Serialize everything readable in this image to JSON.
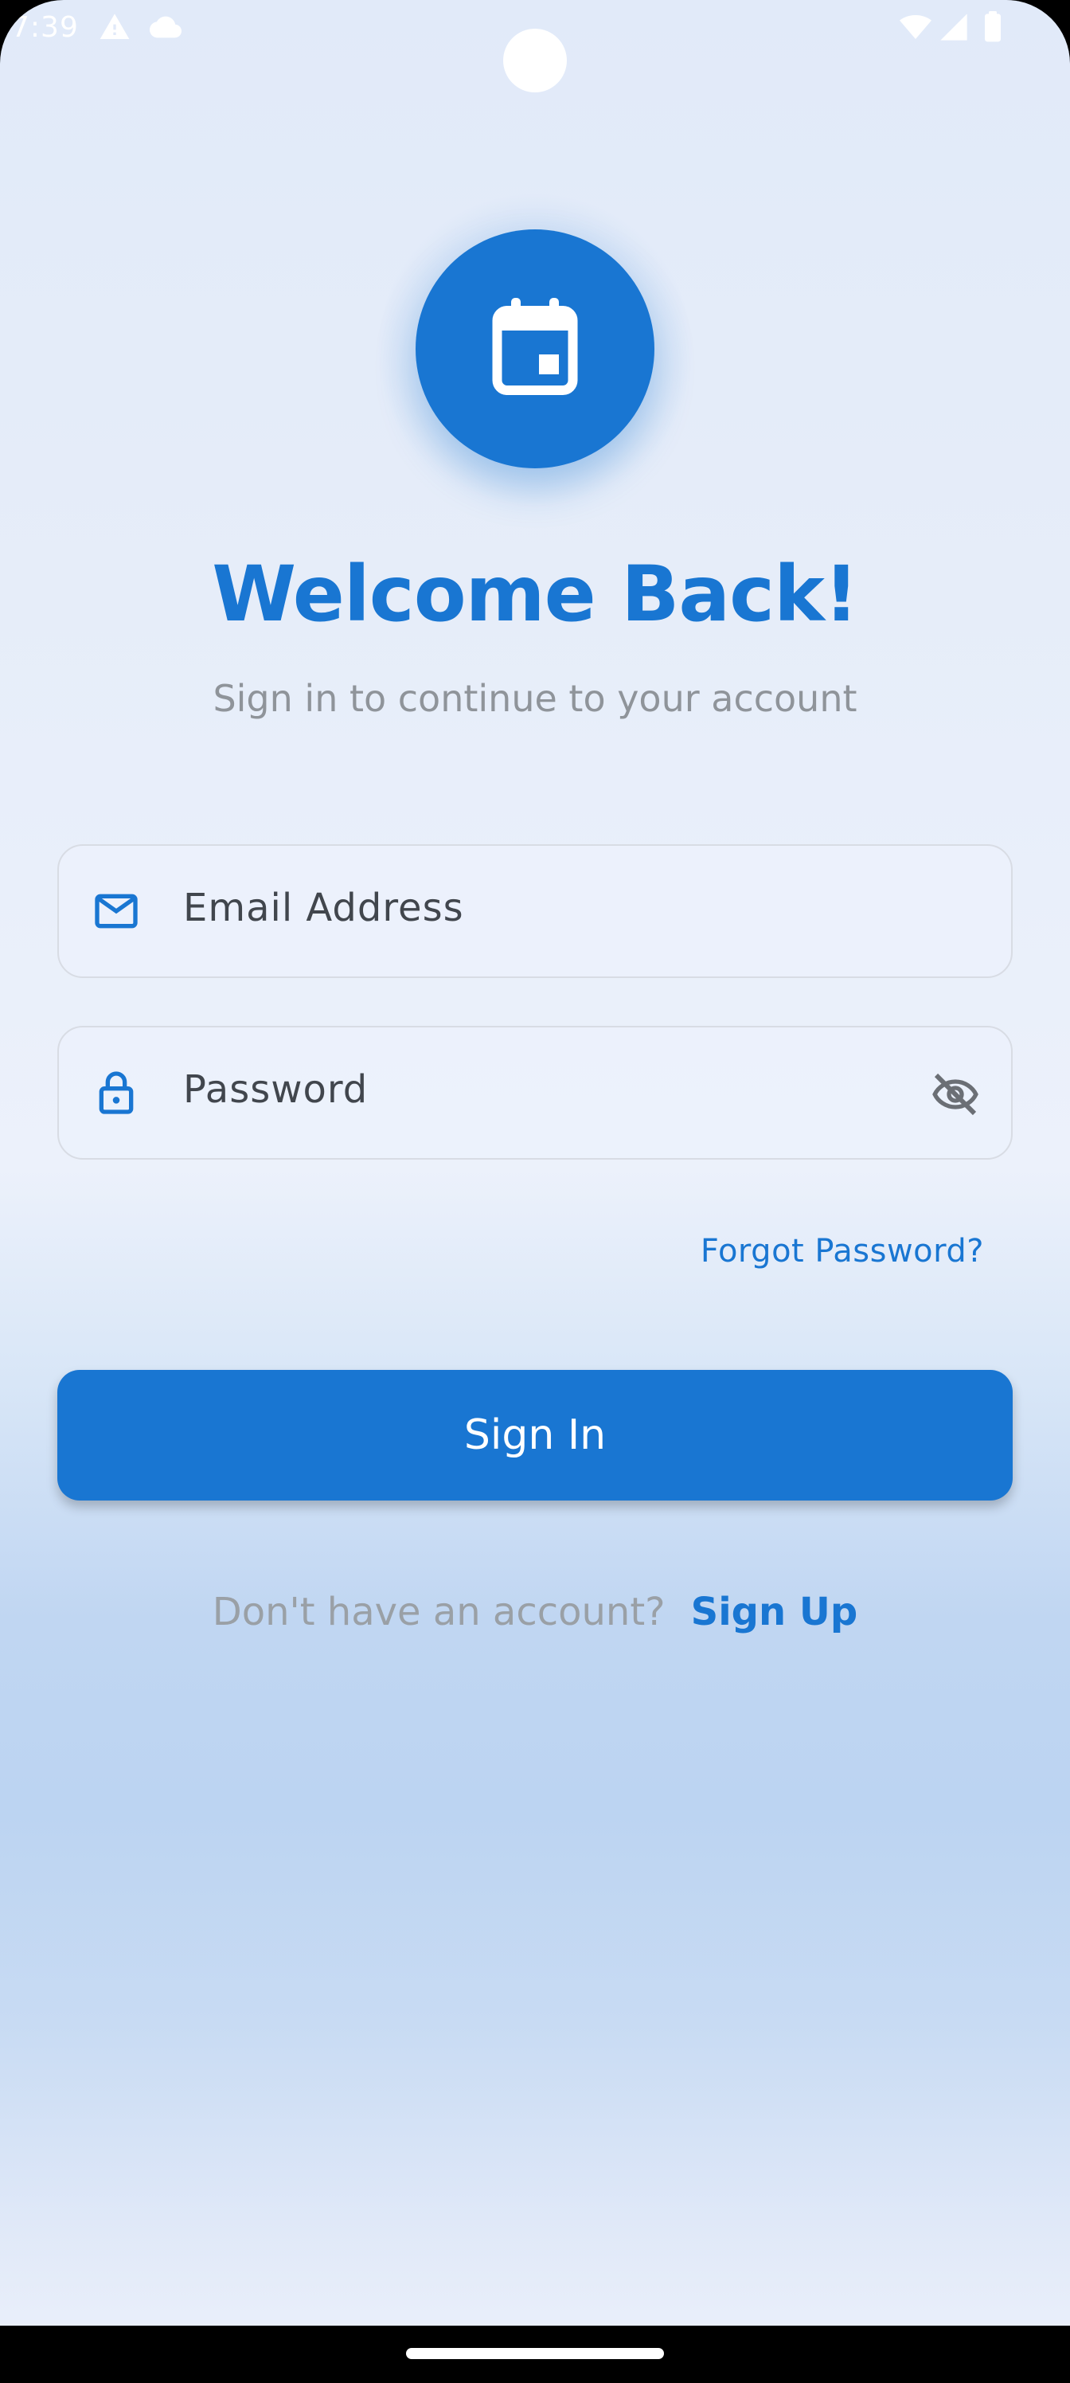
{
  "status_bar": {
    "time": "7:39",
    "icons": [
      "alert-icon",
      "cloud-icon",
      "wifi-icon",
      "signal-icon",
      "battery-icon"
    ]
  },
  "logo": {
    "icon": "calendar-icon",
    "color": "#1976d2"
  },
  "header": {
    "title": "Welcome Back!",
    "subtitle": "Sign in to continue to your account"
  },
  "form": {
    "email": {
      "placeholder": "Email Address",
      "icon": "mail-icon"
    },
    "password": {
      "placeholder": "Password",
      "icon": "lock-icon",
      "toggle_icon": "visibility-off-icon"
    },
    "forgot_label": "Forgot Password?",
    "submit_label": "Sign In"
  },
  "footer": {
    "prompt": "Don't have an account?",
    "link_label": "Sign Up"
  },
  "colors": {
    "accent": "#1976d2",
    "muted_text": "#8f949a",
    "field_border": "#d8dce4"
  }
}
